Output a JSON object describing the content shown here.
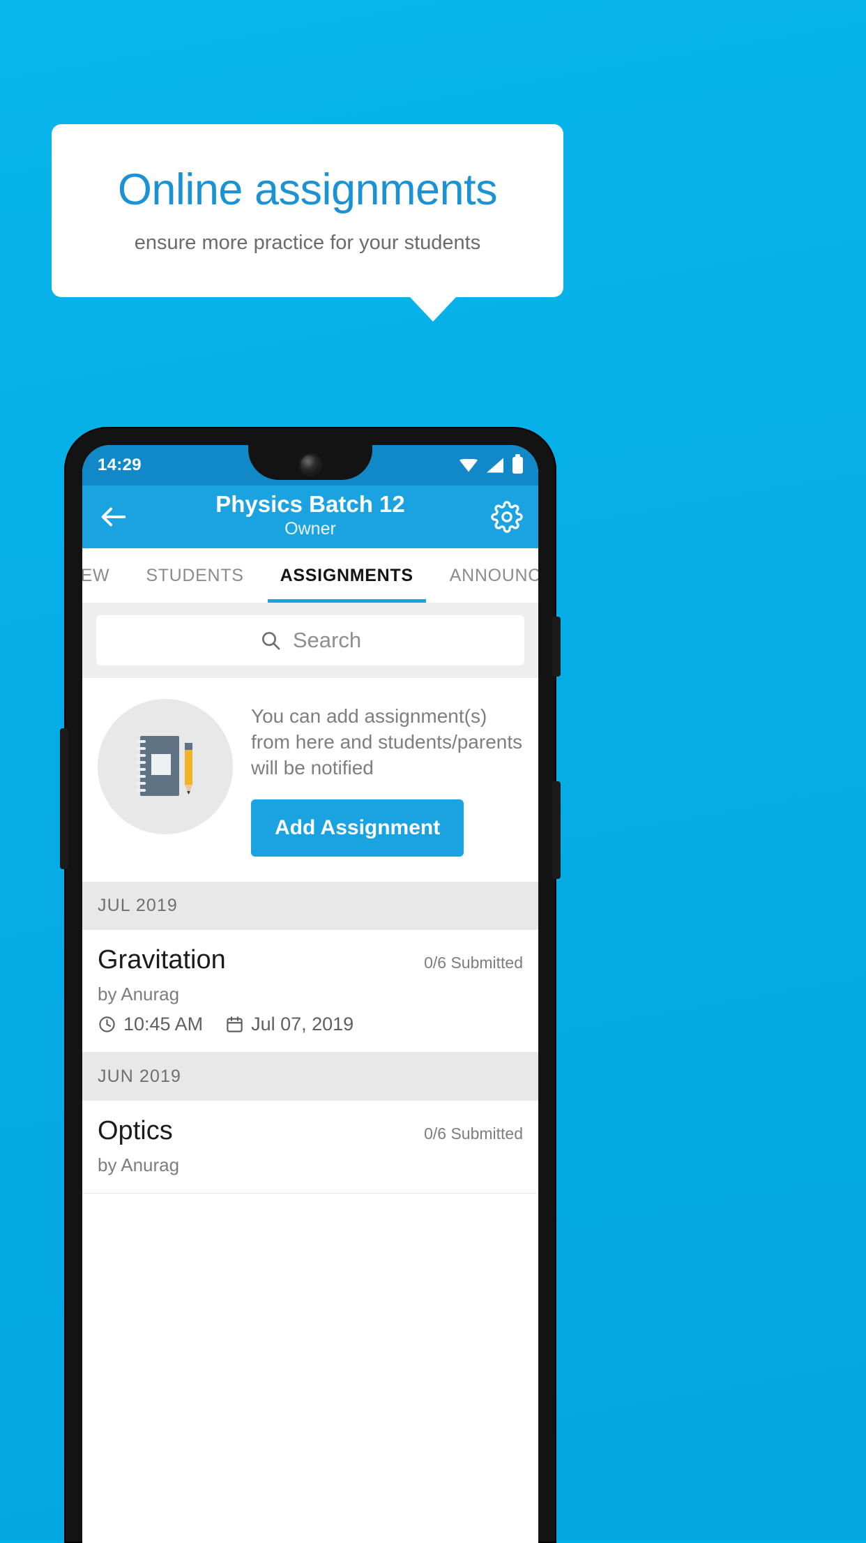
{
  "promo": {
    "title": "Online assignments",
    "subtitle": "ensure more practice for your students",
    "accent_color": "#1a92d4",
    "background_color": "#05ade6"
  },
  "phone": {
    "status_bar": {
      "time": "14:29",
      "icons": [
        "wifi-icon",
        "signal-icon",
        "battery-icon"
      ],
      "background_color": "#1189c9"
    },
    "app_bar": {
      "back_icon": "back-arrow-icon",
      "title": "Physics Batch 12",
      "subtitle": "Owner",
      "settings_icon": "gear-icon",
      "background_color": "#1aa3e0"
    },
    "tabs": [
      {
        "label": "IEW",
        "active": false
      },
      {
        "label": "STUDENTS",
        "active": false
      },
      {
        "label": "ASSIGNMENTS",
        "active": true
      },
      {
        "label": "ANNOUNCEM",
        "active": false
      }
    ],
    "search": {
      "icon": "search-icon",
      "placeholder": "Search",
      "value": ""
    },
    "empty_state": {
      "illustration": "notebook-and-pencil-icon",
      "message": "You can add assignment(s) from here and students/parents will be notified",
      "button_label": "Add Assignment"
    },
    "groups": [
      {
        "month": "JUL 2019",
        "items": [
          {
            "title": "Gravitation",
            "submitted": "0/6 Submitted",
            "author": "by Anurag",
            "time": "10:45 AM",
            "date": "Jul 07, 2019",
            "clock_icon": "clock-icon",
            "calendar_icon": "calendar-icon"
          }
        ]
      },
      {
        "month": "JUN 2019",
        "items": [
          {
            "title": "Optics",
            "submitted": "0/6 Submitted",
            "author": "by Anurag",
            "time": "",
            "date": "",
            "clock_icon": "clock-icon",
            "calendar_icon": "calendar-icon"
          }
        ]
      }
    ]
  }
}
